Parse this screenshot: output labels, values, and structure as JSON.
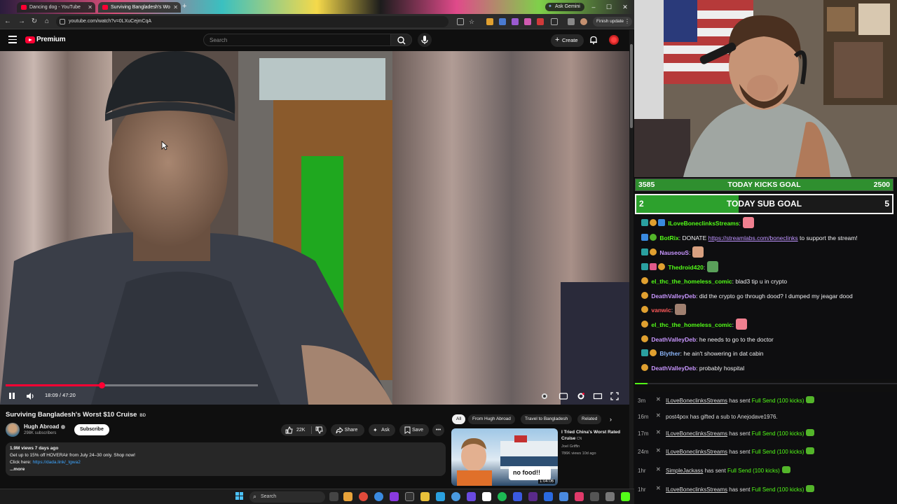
{
  "browser": {
    "tabs": [
      {
        "label": "Dancing dog - YouTube"
      },
      {
        "label": "Surviving Bangladesh's Wo"
      }
    ],
    "ask_gemini": "Ask Gemini",
    "url": "youtube.com/watch?v=0LXuCejmCqA",
    "finish_update": "Finish update"
  },
  "youtube": {
    "brand": "Premium",
    "search_placeholder": "Search",
    "create_label": "Create"
  },
  "player": {
    "current_time": "18:09",
    "duration": "47:20",
    "time_display": "18:09 / 47:20",
    "progress_fraction": 0.383
  },
  "video": {
    "title": "Surviving Bangladesh's Worst $10 Cruise",
    "title_badge": "BD",
    "channel": "Hugh Abroad",
    "subscribers": "298K subscribers",
    "subscribe_label": "Subscribe",
    "likes": "22K",
    "share_label": "Share",
    "ask_label": "Ask",
    "save_label": "Save",
    "description": {
      "meta": "1.9M views  7 days ago",
      "line1": "Get up to 15% off HOVERAir from July 24–30 only. Shop now!",
      "line2_prefix": "Click here: ",
      "line2_link": "https://dada.link/_tgwa2",
      "more": "...more"
    }
  },
  "related": {
    "chips": [
      "All",
      "From Hugh Abroad",
      "Travel to Bangladesh",
      "Related"
    ],
    "item": {
      "title": "I Tried China's Worst Rated Cruise",
      "title_badge": "CN",
      "channel": "Joel Griffin",
      "stats": "786K views  10d ago",
      "duration": "1:04:06",
      "thumb_text": "no food!!"
    }
  },
  "taskbar": {
    "search_label": "Search"
  },
  "goals": {
    "kicks": {
      "current": "3585",
      "label": "TODAY KICKS GOAL",
      "target": "2500",
      "fill": 1.0
    },
    "subs": {
      "current": "2",
      "label": "TODAY SUB GOAL",
      "target": "5",
      "fill": 0.4
    }
  },
  "chat": [
    {
      "user": "ILoveBoneclinksStreams",
      "color": "#53fc18",
      "text": ":",
      "emote": "#f08090"
    },
    {
      "user": "BotRix",
      "color": "#53fc18",
      "text_before": ": DONATE ",
      "link": "https://streamlabs.com/boneclinks",
      "text": " to support the stream!"
    },
    {
      "user": "NauseouS",
      "color": "#c896ff",
      "text": ":",
      "emote": "#d8a080"
    },
    {
      "user": "Thedroid420",
      "color": "#53fc18",
      "text": ":",
      "emote": "#5aa05a"
    },
    {
      "user": "el_thc_the_homeless_comic",
      "color": "#53fc18",
      "text": ": blad3 tip u in crypto"
    },
    {
      "user": "DeathValleyDeb",
      "color": "#c896ff",
      "text": ": did the crypto go through dood? I dumped my jeagar dood"
    },
    {
      "user": "vanwic",
      "color": "#ff5a5a",
      "text": ":",
      "emote": "#a08070"
    },
    {
      "user": "el_thc_the_homeless_comic",
      "color": "#53fc18",
      "text": ":",
      "emote": "#f08090"
    },
    {
      "user": "DeathValleyDeb",
      "color": "#c896ff",
      "text": ": he needs to go to the doctor"
    },
    {
      "user": "Blyther",
      "color": "#8ab4f8",
      "text": ": he ain't showering in dat cabin"
    },
    {
      "user": "DeathValleyDeb",
      "color": "#c896ff",
      "text": ": probably hospital"
    }
  ],
  "events": [
    {
      "time": "3m",
      "user": "ILoveBoneclinksStreams",
      "action": " has sent ",
      "gift": "Full Send (100 kicks)"
    },
    {
      "time": "16m",
      "user": "post4pox",
      "action": " has gifted a sub to ",
      "target": "Anejodave1976."
    },
    {
      "time": "17m",
      "user": "ILoveBoneclinksStreams",
      "action": " has sent ",
      "gift": "Full Send (100 kicks)"
    },
    {
      "time": "24m",
      "user": "ILoveBoneclinksStreams",
      "action": " has sent ",
      "gift": "Full Send (100 kicks)"
    },
    {
      "time": "1hr",
      "user": "SimpleJackass",
      "action": " has sent ",
      "gift": "Full Send (100 kicks)"
    },
    {
      "time": "1hr",
      "user": "ILoveBoneclinksStreams",
      "action": " has sent ",
      "gift": "Full Send (100 kicks)"
    }
  ]
}
